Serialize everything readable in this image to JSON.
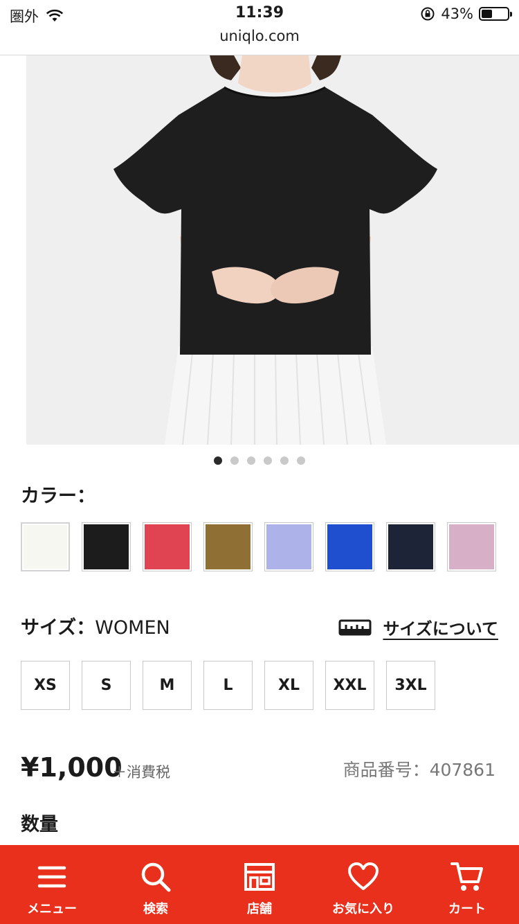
{
  "status_bar": {
    "carrier": "圏外",
    "time": "11:39",
    "url": "uniqlo.com",
    "battery": "43%",
    "battery_level": 0.43
  },
  "gallery": {
    "image_count": 6,
    "active_index": 0
  },
  "color": {
    "label": "カラー：",
    "swatches": [
      {
        "name": "off-white",
        "hex": "#f7f7f2"
      },
      {
        "name": "black",
        "hex": "#1c1c1c"
      },
      {
        "name": "red",
        "hex": "#e04452"
      },
      {
        "name": "olive-brown",
        "hex": "#8f6f33"
      },
      {
        "name": "lavender",
        "hex": "#adb3e8"
      },
      {
        "name": "blue",
        "hex": "#1f4fce"
      },
      {
        "name": "navy",
        "hex": "#1d2438"
      },
      {
        "name": "pink",
        "hex": "#d7b0c8"
      }
    ]
  },
  "size": {
    "label": "サイズ：",
    "value": "WOMEN",
    "guide_label": "サイズについて",
    "options": [
      "XS",
      "S",
      "M",
      "L",
      "XL",
      "XXL",
      "3XL"
    ]
  },
  "price": {
    "amount": "¥1,000",
    "tax_note": "＋消費税",
    "product_code": "商品番号：407861"
  },
  "quantity": {
    "label": "数量"
  },
  "bottom_nav": {
    "color": "#e8301c",
    "items": [
      {
        "label": "メニュー",
        "icon": "menu-icon"
      },
      {
        "label": "検索",
        "icon": "search-icon"
      },
      {
        "label": "店舗",
        "icon": "store-icon"
      },
      {
        "label": "お気に入り",
        "icon": "heart-icon"
      },
      {
        "label": "カート",
        "icon": "cart-icon"
      }
    ]
  }
}
